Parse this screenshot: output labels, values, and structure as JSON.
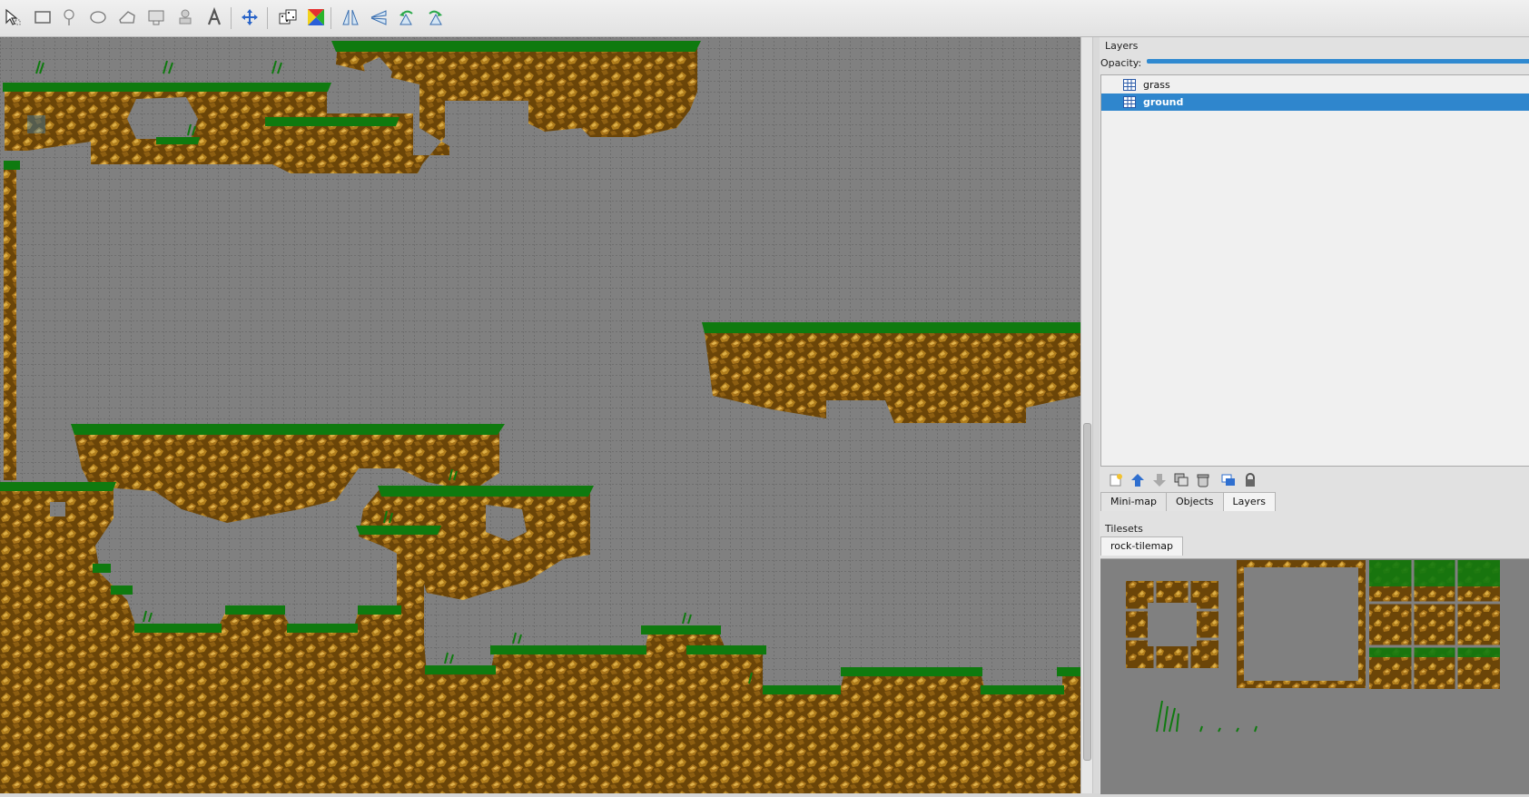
{
  "toolbar": {
    "tools": [
      {
        "icon": "select-arrow-icon"
      },
      {
        "icon": "rectangle-icon"
      },
      {
        "icon": "pin-icon"
      },
      {
        "icon": "ellipse-icon"
      },
      {
        "icon": "polygon-icon"
      },
      {
        "icon": "image-object-icon"
      },
      {
        "icon": "stamp-icon"
      },
      {
        "icon": "text-icon",
        "glyph": "A"
      },
      {
        "icon": "move-icon"
      },
      {
        "icon": "random-dice-icon"
      },
      {
        "icon": "color-square-icon"
      },
      {
        "icon": "flip-horizontal-icon"
      },
      {
        "icon": "flip-vertical-icon"
      },
      {
        "icon": "rotate-left-icon"
      },
      {
        "icon": "rotate-right-icon"
      }
    ]
  },
  "layers_panel": {
    "title": "Layers",
    "opacity_label": "Opacity:",
    "opacity": 1.0,
    "layers": [
      {
        "name": "grass",
        "selected": false,
        "icon": "tile-layer-icon"
      },
      {
        "name": "ground",
        "selected": true,
        "icon": "tile-layer-icon"
      }
    ],
    "tools": [
      {
        "icon": "new-layer-icon"
      },
      {
        "icon": "move-layer-up-icon"
      },
      {
        "icon": "move-layer-down-icon"
      },
      {
        "icon": "duplicate-layer-icon"
      },
      {
        "icon": "delete-layer-icon"
      },
      {
        "icon": "show-layers-icon"
      },
      {
        "icon": "lock-icon"
      }
    ]
  },
  "dock_tabs": [
    {
      "label": "Mini-map",
      "active": false
    },
    {
      "label": "Objects",
      "active": false
    },
    {
      "label": "Layers",
      "active": true
    }
  ],
  "tilesets_panel": {
    "title": "Tilesets",
    "tabs": [
      {
        "label": "rock-tilemap",
        "active": true
      }
    ]
  },
  "colors": {
    "grid_bg": "#808080",
    "grid_line": "#5c5c5c",
    "rock_dark": "#5b3a06",
    "rock_mid": "#9a6a12",
    "rock_light": "#d2a23a",
    "grass": "#0f7a0f",
    "selection": "#2f86cd"
  }
}
